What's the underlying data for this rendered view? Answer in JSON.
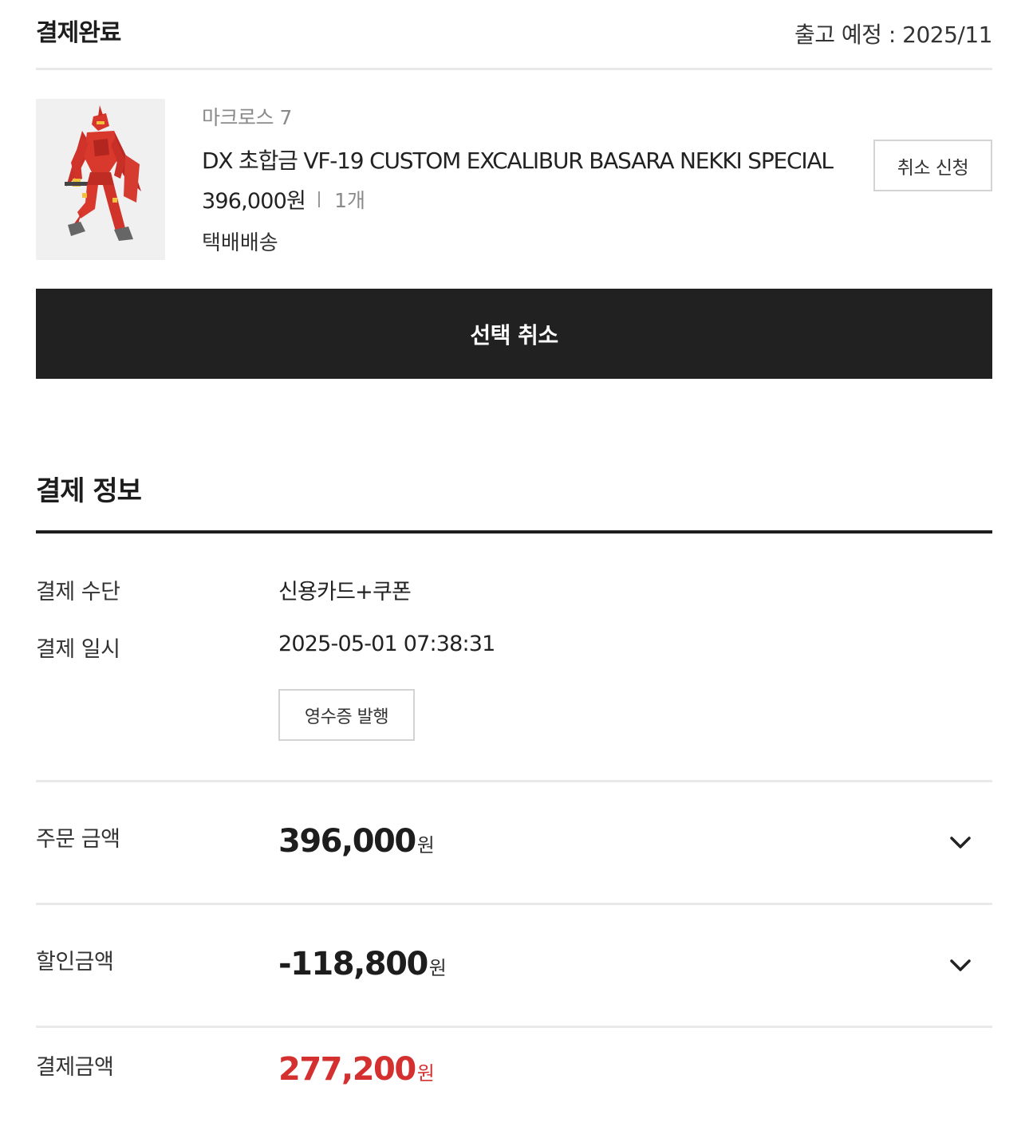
{
  "order": {
    "status": "결제완료",
    "ship_date": "출고 예정 : 2025/11"
  },
  "product": {
    "series": "마크로스 7",
    "name": "DX 초합금 VF-19 CUSTOM EXCALIBUR BASARA NEKKI SPECIAL",
    "price": "396,000원",
    "quantity": "1개",
    "shipping": "택배배송",
    "cancel_request_label": "취소 신청"
  },
  "select_cancel_label": "선택 취소",
  "payment": {
    "title": "결제 정보",
    "method_label": "결제 수단",
    "method_value": "신용카드+쿠폰",
    "datetime_label": "결제 일시",
    "datetime_value": "2025-05-01 07:38:31",
    "receipt_label": "영수증 발행",
    "order_amount_label": "주문 금액",
    "order_amount_value": "396,000",
    "order_amount_unit": "원",
    "discount_label": "할인금액",
    "discount_value": "-118,800",
    "discount_unit": "원",
    "total_label": "결제금액",
    "total_value": "277,200",
    "total_unit": "원"
  },
  "colors": {
    "accent_red": "#d3302f",
    "dark_bar": "#212121",
    "divider": "#e9e9e9"
  },
  "icons": {
    "order_expand": "chevron-down-icon",
    "discount_expand": "chevron-down-icon"
  }
}
